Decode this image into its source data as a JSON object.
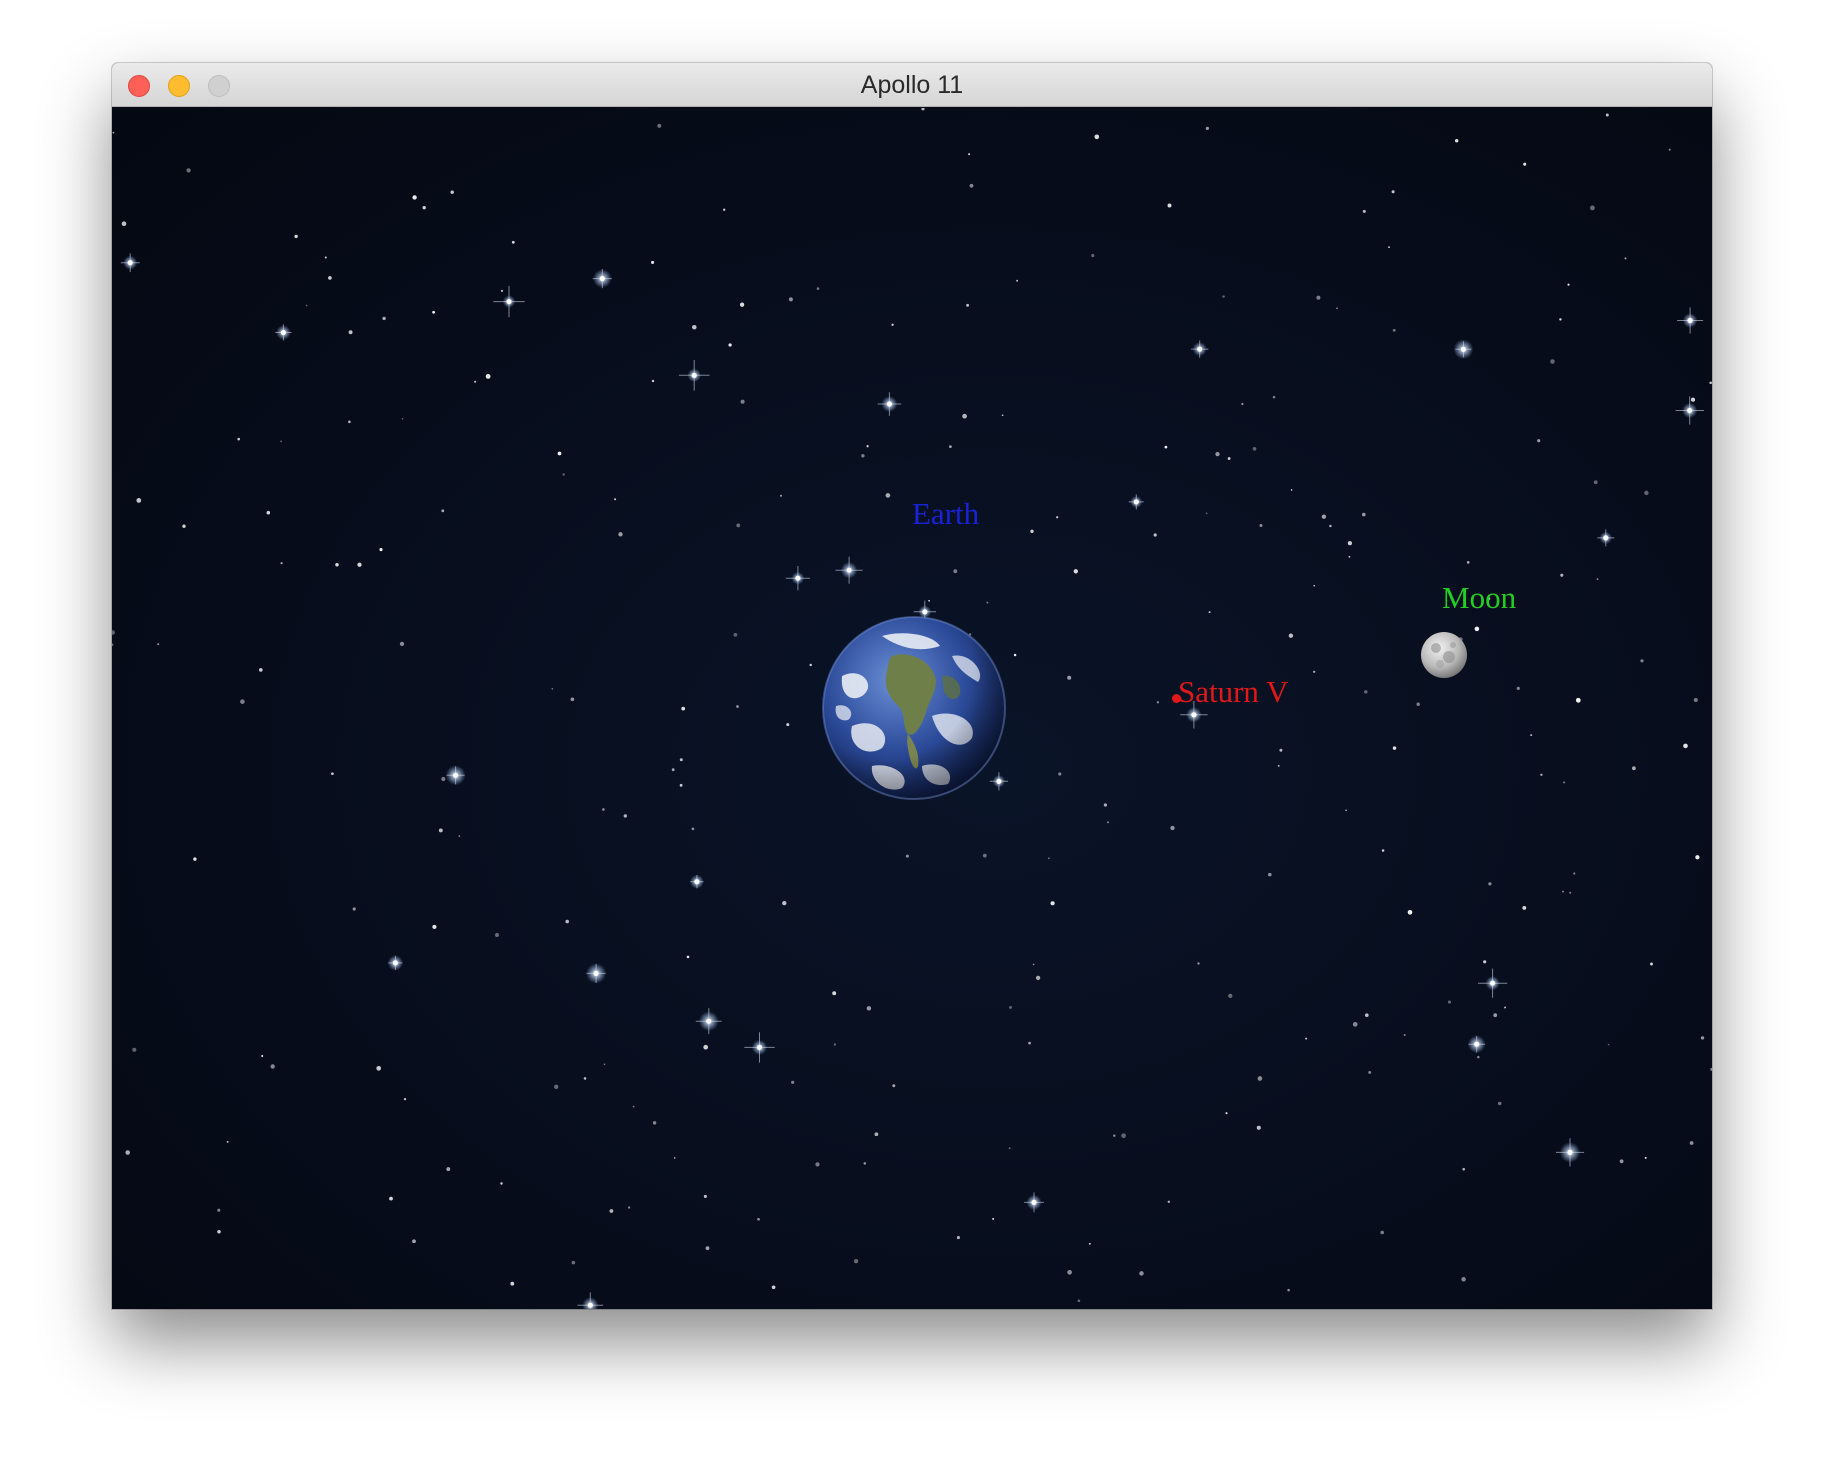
{
  "window": {
    "title": "Apollo 11",
    "traffic_lights": {
      "close": "close-button",
      "minimize": "minimize-button",
      "zoom": "zoom-button"
    }
  },
  "scene": {
    "background": "starfield",
    "bodies": {
      "earth": {
        "label": "Earth",
        "label_color": "#1a22d8"
      },
      "moon": {
        "label": "Moon",
        "label_color": "#22d022"
      },
      "spacecraft": {
        "label": "Saturn V",
        "label_color": "#e01818"
      }
    }
  }
}
